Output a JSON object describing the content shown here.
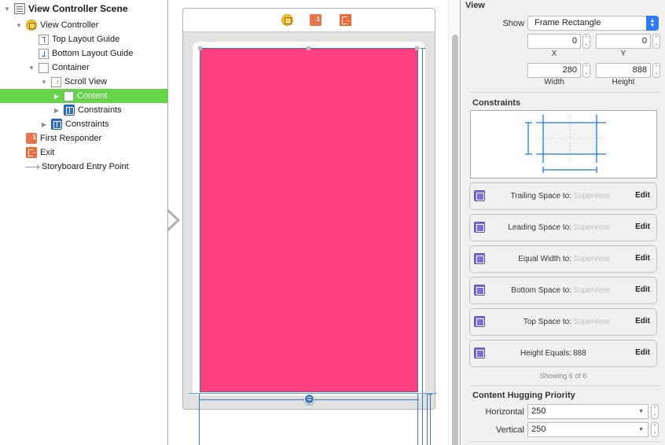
{
  "outline": {
    "items": [
      {
        "label": "View Controller Scene",
        "icon": "scene-icon",
        "disclosure": "expanded"
      },
      {
        "label": "View Controller",
        "icon": "view-controller-icon",
        "disclosure": "expanded"
      },
      {
        "label": "Top Layout Guide",
        "icon": "top-layout-guide-icon",
        "disclosure": "none"
      },
      {
        "label": "Bottom Layout Guide",
        "icon": "bottom-layout-guide-icon",
        "disclosure": "none"
      },
      {
        "label": "Container",
        "icon": "view-icon",
        "disclosure": "expanded"
      },
      {
        "label": "Scroll View",
        "icon": "scroll-view-icon",
        "disclosure": "expanded"
      },
      {
        "label": "Content",
        "icon": "view-icon",
        "disclosure": "collapsed",
        "selected": true
      },
      {
        "label": "Constraints",
        "icon": "constraints-icon",
        "disclosure": "collapsed"
      },
      {
        "label": "Constraints",
        "icon": "constraints-icon",
        "disclosure": "collapsed"
      },
      {
        "label": "First Responder",
        "icon": "first-responder-icon",
        "disclosure": "none"
      },
      {
        "label": "Exit",
        "icon": "exit-icon",
        "disclosure": "none"
      },
      {
        "label": "Storyboard Entry Point",
        "icon": "entry-point-arrow-icon",
        "disclosure": "none"
      }
    ]
  },
  "canvas": {
    "dock_icons": [
      "view-controller-icon",
      "first-responder-icon",
      "exit-icon"
    ],
    "content_color": "#fe3f7d",
    "selection_color": "#3c78b4"
  },
  "inspector": {
    "view": {
      "title": "View",
      "show_label": "Show",
      "show_value": "Frame Rectangle",
      "x_value": "0",
      "x_label": "X",
      "y_value": "0",
      "y_label": "Y",
      "width_value": "280",
      "width_label": "Width",
      "height_value": "888",
      "height_label": "Height"
    },
    "constraints": {
      "title": "Constraints",
      "rows": [
        {
          "label": "Trailing Space to:",
          "target": "Superview",
          "edit": "Edit",
          "icon": "trailing-space-icon"
        },
        {
          "label": "Leading Space to:",
          "target": "Superview",
          "edit": "Edit",
          "icon": "leading-space-icon"
        },
        {
          "label": "Equal Width to:",
          "target": "Superview",
          "edit": "Edit",
          "icon": "equal-width-icon"
        },
        {
          "label": "Bottom Space to:",
          "target": "Superview",
          "edit": "Edit",
          "icon": "bottom-space-icon"
        },
        {
          "label": "Top Space to:",
          "target": "Superview",
          "edit": "Edit",
          "icon": "top-space-icon"
        },
        {
          "label": "Height Equals:",
          "target": "888",
          "edit": "Edit",
          "icon": "height-icon"
        }
      ],
      "showing": "Showing 6 of 6"
    },
    "hugging": {
      "title": "Content Hugging Priority",
      "horizontal_label": "Horizontal",
      "horizontal_value": "250",
      "vertical_label": "Vertical",
      "vertical_value": "250"
    }
  }
}
